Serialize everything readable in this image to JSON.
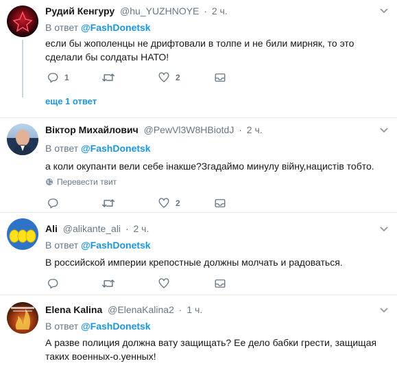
{
  "tweets": [
    {
      "name": "Рудий Кенгуру",
      "handle": "@hu_YUZHNOYE",
      "time": "2 ч.",
      "reply_prefix": "В ответ",
      "reply_mention": "@FashDonetsk",
      "text": "если бы жополенцы не дрифтовали в толпе и не били мирняк, то это сделали бы солдаты НАТО!",
      "reply_count": "1",
      "retweet_count": "",
      "like_count": "2",
      "more_replies": "еще 1 ответ"
    },
    {
      "name": "Віктор Михайлович",
      "handle": "@PewVl3W8HBiotdJ",
      "time": "2 ч.",
      "reply_prefix": "В ответ",
      "reply_mention": "@FashDonetsk",
      "text": "а коли окупанти вели себе інакше?Згадаймо минулу війну,нацистів тобто.",
      "translate": "Перевести твит",
      "reply_count": "",
      "retweet_count": "",
      "like_count": "2"
    },
    {
      "name": "Ali",
      "handle": "@alikante_ali",
      "time": "2 ч.",
      "reply_prefix": "В ответ",
      "reply_mention": "@FashDonetsk",
      "text": "В российской империи крепостные должны молчать и радоваться.",
      "reply_count": "",
      "retweet_count": "",
      "like_count": ""
    },
    {
      "name": "Elena Kalina",
      "handle": "@ElenaKalina2",
      "time": "1 ч.",
      "reply_prefix": "В ответ",
      "reply_mention": "@FashDonetsk",
      "text": "А разве полиция должна вату защищать? Ее дело бабки грести, защищая таких военных-о.уенных!",
      "reply_count": "",
      "retweet_count": "",
      "like_count": ""
    }
  ],
  "colors": {
    "link": "#1b95e0",
    "muted": "#657786",
    "divider": "#e6ecf0"
  },
  "icons": [
    "reply-icon",
    "retweet-icon",
    "like-icon",
    "dm-icon",
    "caret-down-icon",
    "globe-icon"
  ]
}
